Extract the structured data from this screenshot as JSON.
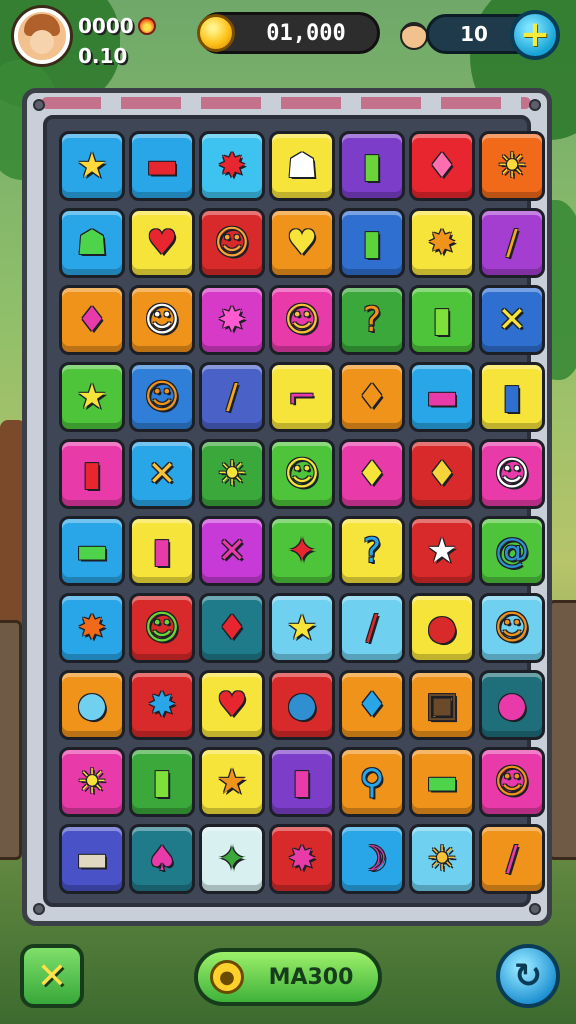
{
  "hud": {
    "player": {
      "score_top": "0000",
      "score_bottom": "0.10"
    },
    "coins": "01,000",
    "lives": "10"
  },
  "bottom": {
    "main_button_label": "MA300"
  },
  "board": {
    "rows": [
      [
        {
          "bg": "#29a6e8",
          "glyph": "★",
          "color": "#ffd83a"
        },
        {
          "bg": "#29a6e8",
          "glyph": "▬",
          "color": "#e8262f"
        },
        {
          "bg": "#3ec3f0",
          "glyph": "✸",
          "color": "#e8262f"
        },
        {
          "bg": "#f7e43a",
          "glyph": "☗",
          "color": "#ffffff"
        },
        {
          "bg": "#7c3ec9",
          "glyph": "▮",
          "color": "#6ad43a"
        },
        {
          "bg": "#e8262f",
          "glyph": "♦",
          "color": "#ff6fb0"
        },
        {
          "bg": "#f06a1a",
          "glyph": "☀",
          "color": "#ffd83a"
        }
      ],
      [
        {
          "bg": "#29a6e8",
          "glyph": "☗",
          "color": "#4dd44a"
        },
        {
          "bg": "#f7e43a",
          "glyph": "♥",
          "color": "#e8262f"
        },
        {
          "bg": "#d82a2a",
          "glyph": "☺",
          "color": "#f7a23a"
        },
        {
          "bg": "#f0931a",
          "glyph": "♥",
          "color": "#f7e43a"
        },
        {
          "bg": "#2f6fd0",
          "glyph": "▮",
          "color": "#5ad43a"
        },
        {
          "bg": "#f7e43a",
          "glyph": "✸",
          "color": "#f0931a"
        },
        {
          "bg": "#a43ed0",
          "glyph": "/",
          "color": "#f0a81a"
        }
      ],
      [
        {
          "bg": "#f0931a",
          "glyph": "♦",
          "color": "#e83aa8"
        },
        {
          "bg": "#f0931a",
          "glyph": "☺",
          "color": "#ffffff"
        },
        {
          "bg": "#d83ac8",
          "glyph": "✸",
          "color": "#ff5ad0"
        },
        {
          "bg": "#e83aa8",
          "glyph": "☺",
          "color": "#f7c23a"
        },
        {
          "bg": "#3aa83a",
          "glyph": "?",
          "color": "#f0931a"
        },
        {
          "bg": "#4dc43a",
          "glyph": "▮",
          "color": "#7fe03a"
        },
        {
          "bg": "#2f6fd0",
          "glyph": "✕",
          "color": "#f7e43a"
        }
      ],
      [
        {
          "bg": "#4dc43a",
          "glyph": "★",
          "color": "#f7e43a"
        },
        {
          "bg": "#2f7fd8",
          "glyph": "☺",
          "color": "#f0931a"
        },
        {
          "bg": "#4a62c8",
          "glyph": "/",
          "color": "#f0a81a"
        },
        {
          "bg": "#f7e43a",
          "glyph": "⌐",
          "color": "#e83aa8"
        },
        {
          "bg": "#f0931a",
          "glyph": "♦",
          "color": "#f0931a"
        },
        {
          "bg": "#29a6e8",
          "glyph": "▬",
          "color": "#e83aa8"
        },
        {
          "bg": "#f7e43a",
          "glyph": "▮",
          "color": "#2f6fd0"
        }
      ],
      [
        {
          "bg": "#e83aa8",
          "glyph": "▮",
          "color": "#e8262f"
        },
        {
          "bg": "#29a6e8",
          "glyph": "✕",
          "color": "#f7c23a"
        },
        {
          "bg": "#3aa83a",
          "glyph": "☀",
          "color": "#f7e43a"
        },
        {
          "bg": "#4dc43a",
          "glyph": "☺",
          "color": "#f7e43a"
        },
        {
          "bg": "#e83aa8",
          "glyph": "♦",
          "color": "#f7e43a"
        },
        {
          "bg": "#d82a2a",
          "glyph": "♦",
          "color": "#f7d43a"
        },
        {
          "bg": "#e83aa8",
          "glyph": "☺",
          "color": "#ffffff"
        }
      ],
      [
        {
          "bg": "#29a6e8",
          "glyph": "▬",
          "color": "#4dd44a"
        },
        {
          "bg": "#f7e43a",
          "glyph": "▮",
          "color": "#e83aa8"
        },
        {
          "bg": "#c83ad8",
          "glyph": "✕",
          "color": "#e83aa8"
        },
        {
          "bg": "#4dc43a",
          "glyph": "✦",
          "color": "#e8262f"
        },
        {
          "bg": "#f7e43a",
          "glyph": "?",
          "color": "#29a6e8"
        },
        {
          "bg": "#d82a2a",
          "glyph": "★",
          "color": "#ffffff"
        },
        {
          "bg": "#4dc43a",
          "glyph": "@",
          "color": "#2f8fd0"
        }
      ],
      [
        {
          "bg": "#29a6e8",
          "glyph": "✸",
          "color": "#f06a1a"
        },
        {
          "bg": "#d82a2a",
          "glyph": "☺",
          "color": "#6ad43a"
        },
        {
          "bg": "#1f7a8a",
          "glyph": "♦",
          "color": "#e8262f"
        },
        {
          "bg": "#6fd0f0",
          "glyph": "★",
          "color": "#f7e43a"
        },
        {
          "bg": "#6fd0f0",
          "glyph": "/",
          "color": "#d82a2a"
        },
        {
          "bg": "#f7e43a",
          "glyph": "●",
          "color": "#d82a2a"
        },
        {
          "bg": "#6fd0f0",
          "glyph": "☺",
          "color": "#f0931a"
        }
      ],
      [
        {
          "bg": "#f0931a",
          "glyph": "●",
          "color": "#6fd0f0"
        },
        {
          "bg": "#d82a2a",
          "glyph": "✸",
          "color": "#29a6e8"
        },
        {
          "bg": "#f7e43a",
          "glyph": "♥",
          "color": "#e8262f"
        },
        {
          "bg": "#d82a2a",
          "glyph": "●",
          "color": "#2f8fd0"
        },
        {
          "bg": "#f0931a",
          "glyph": "♦",
          "color": "#29a6e8"
        },
        {
          "bg": "#f0931a",
          "glyph": "▣",
          "color": "#6b4a2a"
        },
        {
          "bg": "#1f6f7a",
          "glyph": "●",
          "color": "#e83aa8"
        }
      ],
      [
        {
          "bg": "#e83aa8",
          "glyph": "☀",
          "color": "#f7e43a"
        },
        {
          "bg": "#3aa83a",
          "glyph": "▮",
          "color": "#7fe03a"
        },
        {
          "bg": "#f7e43a",
          "glyph": "★",
          "color": "#f0931a"
        },
        {
          "bg": "#7c3ec9",
          "glyph": "▮",
          "color": "#e83aa8"
        },
        {
          "bg": "#f0931a",
          "glyph": "⚲",
          "color": "#29a6e8"
        },
        {
          "bg": "#f0931a",
          "glyph": "▬",
          "color": "#4dd44a"
        },
        {
          "bg": "#e83aa8",
          "glyph": "☺",
          "color": "#f0931a"
        }
      ],
      [
        {
          "bg": "#4a52c8",
          "glyph": "▬",
          "color": "#e0d8c0"
        },
        {
          "bg": "#1f7a8a",
          "glyph": "♠",
          "color": "#e83aa8"
        },
        {
          "bg": "#d8f0f0",
          "glyph": "✦",
          "color": "#3aa83a"
        },
        {
          "bg": "#d82a2a",
          "glyph": "✸",
          "color": "#e83aa8"
        },
        {
          "bg": "#29a6e8",
          "glyph": "☽",
          "color": "#e83aa8"
        },
        {
          "bg": "#6fd0f0",
          "glyph": "☀",
          "color": "#f7c23a"
        },
        {
          "bg": "#f0931a",
          "glyph": "/",
          "color": "#e83aa8"
        }
      ]
    ]
  }
}
